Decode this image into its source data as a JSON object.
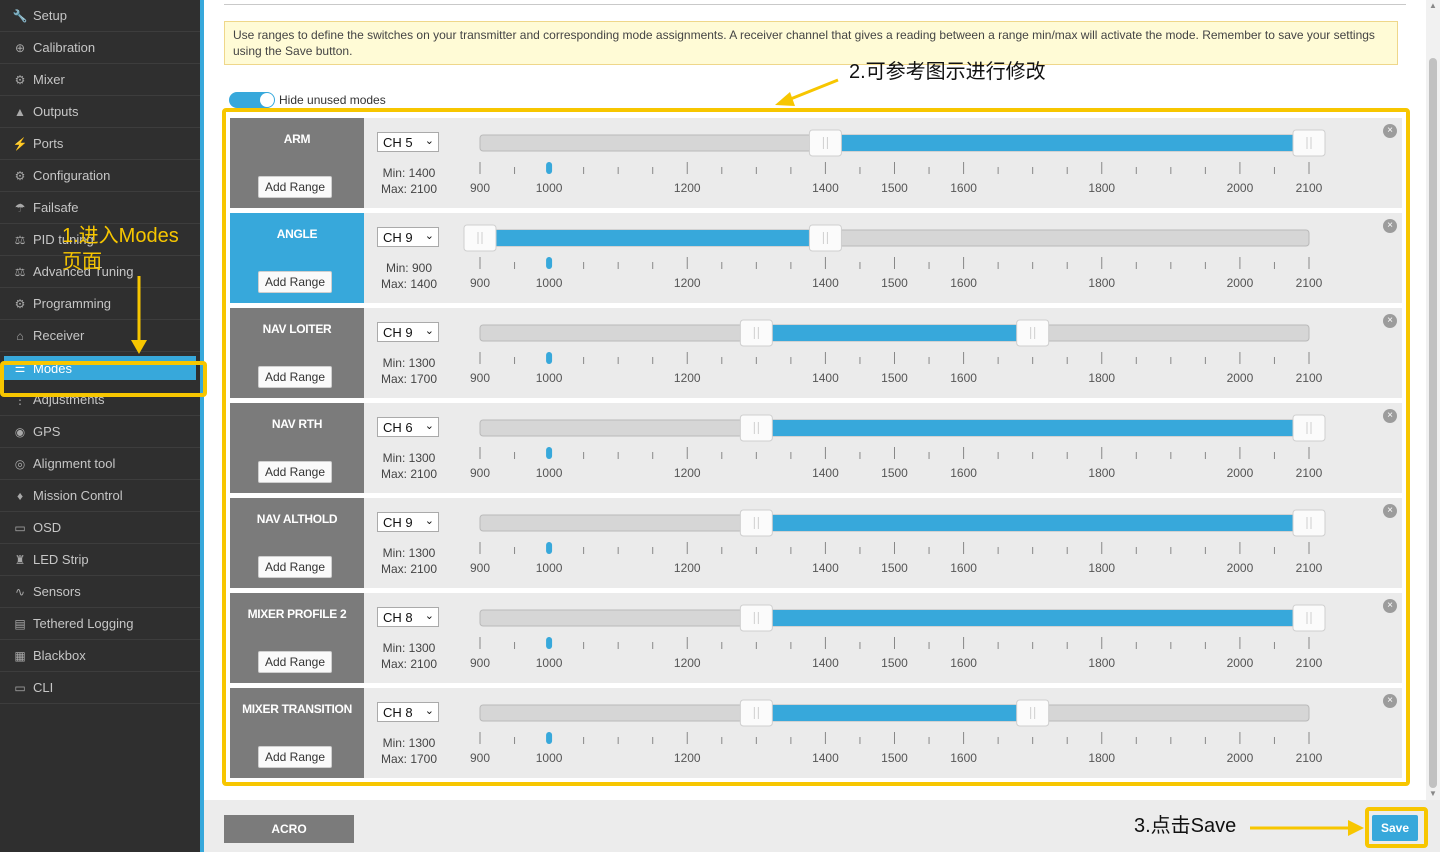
{
  "sidebar": {
    "items": [
      {
        "label": "Setup",
        "icon": "wrench-icon",
        "glyph": "🔧"
      },
      {
        "label": "Calibration",
        "icon": "crosshair-icon",
        "glyph": "⊕"
      },
      {
        "label": "Mixer",
        "icon": "mixer-icon",
        "glyph": "⚙"
      },
      {
        "label": "Outputs",
        "icon": "output-icon",
        "glyph": "▲"
      },
      {
        "label": "Ports",
        "icon": "plug-icon",
        "glyph": "⚡"
      },
      {
        "label": "Configuration",
        "icon": "gear-icon",
        "glyph": "⚙"
      },
      {
        "label": "Failsafe",
        "icon": "parachute-icon",
        "glyph": "☂"
      },
      {
        "label": "PID tuning",
        "icon": "pid-icon",
        "glyph": "⚖"
      },
      {
        "label": "Advanced Tuning",
        "icon": "advanced-tuning-icon",
        "glyph": "⚖"
      },
      {
        "label": "Programming",
        "icon": "gears-icon",
        "glyph": "⚙"
      },
      {
        "label": "Receiver",
        "icon": "receiver-icon",
        "glyph": "⌂"
      },
      {
        "label": "Modes",
        "icon": "toggles-icon",
        "glyph": "☰",
        "active": true
      },
      {
        "label": "Adjustments",
        "icon": "sliders-icon",
        "glyph": "⋮"
      },
      {
        "label": "GPS",
        "icon": "globe-icon",
        "glyph": "◉"
      },
      {
        "label": "Alignment tool",
        "icon": "compass-icon",
        "glyph": "◎"
      },
      {
        "label": "Mission Control",
        "icon": "map-marker-icon",
        "glyph": "♦"
      },
      {
        "label": "OSD",
        "icon": "osd-icon",
        "glyph": "▭"
      },
      {
        "label": "LED Strip",
        "icon": "led-icon",
        "glyph": "♜"
      },
      {
        "label": "Sensors",
        "icon": "pulse-icon",
        "glyph": "∿"
      },
      {
        "label": "Tethered Logging",
        "icon": "log-icon",
        "glyph": "▤"
      },
      {
        "label": "Blackbox",
        "icon": "blackbox-icon",
        "glyph": "▦"
      },
      {
        "label": "CLI",
        "icon": "terminal-icon",
        "glyph": "▭"
      }
    ]
  },
  "note": "Use ranges to define the switches on your transmitter and corresponding mode assignments. A receiver channel that gives a reading between a range min/max will activate the mode. Remember to save your settings using the Save button.",
  "toggle_label": "Hide unused modes",
  "slider_scale": {
    "min": 900,
    "max": 2100,
    "labels": [
      900,
      1000,
      1200,
      1400,
      1500,
      1600,
      1800,
      2000,
      2100
    ]
  },
  "add_range_label": "Add Range",
  "min_prefix": "Min: ",
  "max_prefix": "Max: ",
  "modes": [
    {
      "name": "ARM",
      "channel": "CH 5",
      "min": 1400,
      "max": 2100,
      "marker": 1000,
      "active": false
    },
    {
      "name": "ANGLE",
      "channel": "CH 9",
      "min": 900,
      "max": 1400,
      "marker": 1000,
      "active": true
    },
    {
      "name": "NAV LOITER",
      "channel": "CH 9",
      "min": 1300,
      "max": 1700,
      "marker": 1000,
      "active": false
    },
    {
      "name": "NAV RTH",
      "channel": "CH 6",
      "min": 1300,
      "max": 2100,
      "marker": 1000,
      "active": false
    },
    {
      "name": "NAV ALTHOLD",
      "channel": "CH 9",
      "min": 1300,
      "max": 2100,
      "marker": 1000,
      "active": false
    },
    {
      "name": "MIXER PROFILE 2",
      "channel": "CH 8",
      "min": 1300,
      "max": 2100,
      "marker": 1000,
      "active": false
    },
    {
      "name": "MIXER TRANSITION",
      "channel": "CH 8",
      "min": 1300,
      "max": 1700,
      "marker": 1000,
      "active": false
    }
  ],
  "bottom": {
    "profile_label": "ACRO",
    "save_label": "Save"
  },
  "annotations": {
    "step1": "1.进入Modes页面",
    "step2": "2.可参考图示进行修改",
    "step3": "3.点击Save",
    "color": "#f7c600"
  },
  "colors": {
    "accent": "#37a8db",
    "mode_inactive": "#7b7b7b",
    "sidebar_bg": "#2f2f2f"
  }
}
